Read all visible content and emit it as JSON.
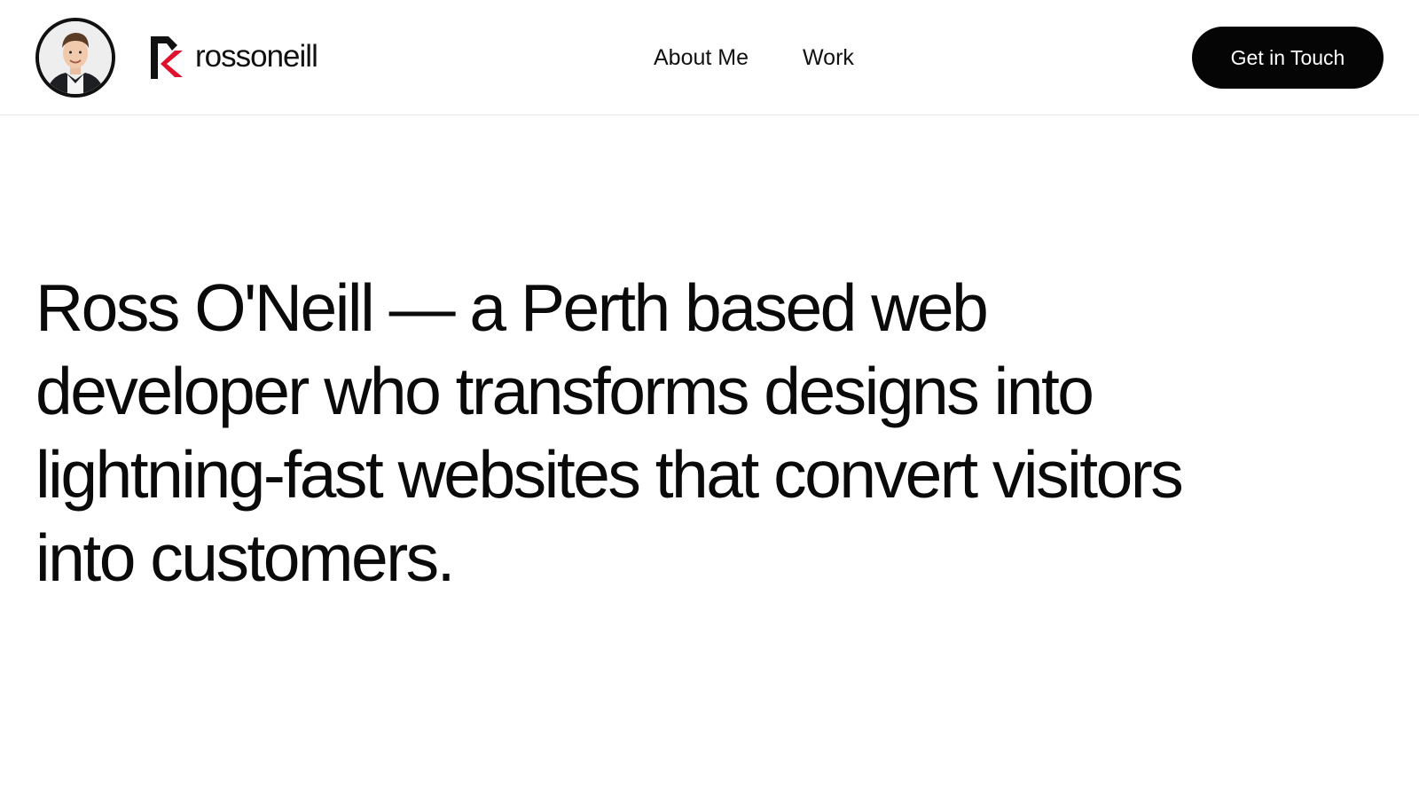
{
  "header": {
    "avatar_alt": "Ross O'Neill",
    "logo_text": "rossoneill",
    "nav": [
      {
        "label": "About Me"
      },
      {
        "label": "Work"
      }
    ],
    "cta_label": "Get in Touch"
  },
  "hero": {
    "headline": "Ross O'Neill — a Perth based web developer who transforms designs into lightning-fast websites that convert visitors into customers."
  },
  "colors": {
    "text": "#111111",
    "cta_background": "#050505",
    "cta_text": "#ffffff",
    "logo_accent": "#e0132f",
    "background": "#ffffff"
  },
  "icons": {
    "avatar": "profile-photo",
    "logo_mark": "rk-logo-mark"
  }
}
